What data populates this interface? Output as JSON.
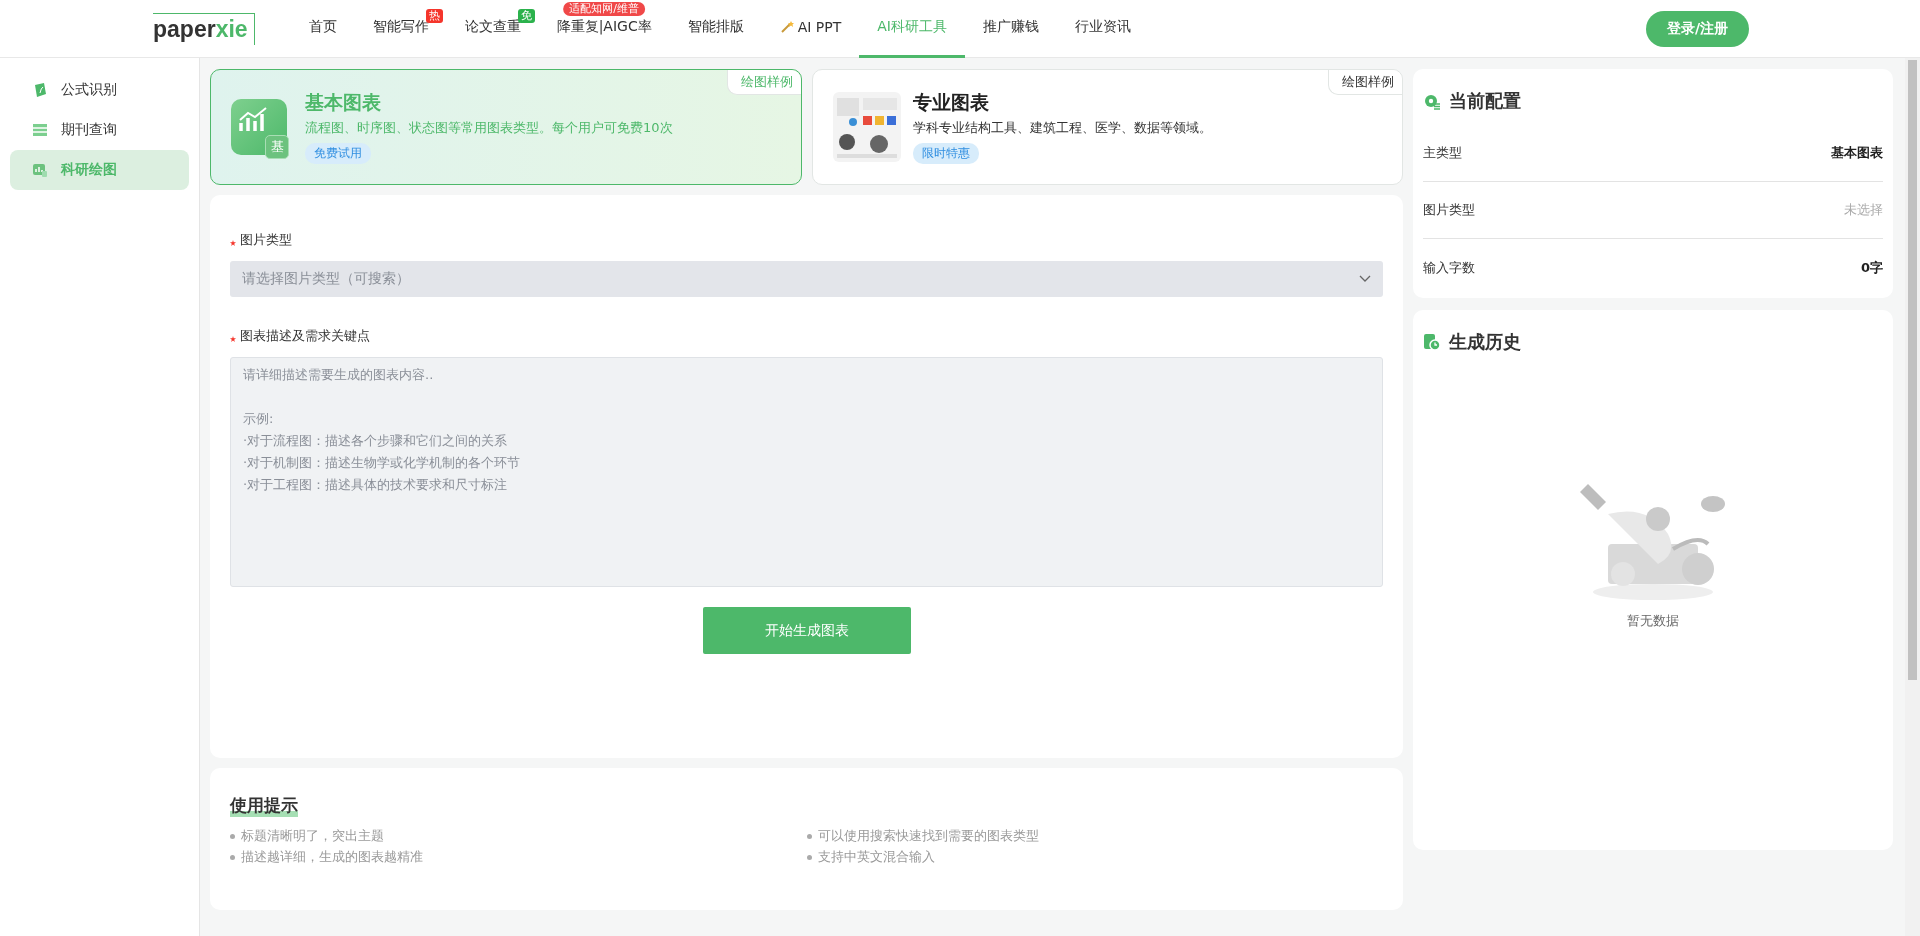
{
  "header": {
    "logo": {
      "dark": "paper",
      "green": "xie"
    },
    "nav": [
      {
        "label": "首页",
        "selected": false
      },
      {
        "label": "智能写作",
        "selected": false,
        "badge": {
          "text": "热",
          "kind": "corner",
          "color": "#f5352b"
        }
      },
      {
        "label": "论文查重",
        "selected": false,
        "badge": {
          "text": "免",
          "kind": "corner",
          "color": "#2bb24c"
        }
      },
      {
        "label": "降重复|AIGC率",
        "selected": false,
        "badge": {
          "text": "适配知网/维普",
          "kind": "pill",
          "color": "#f04848"
        }
      },
      {
        "label": "智能排版",
        "selected": false
      },
      {
        "label": "AI PPT",
        "selected": false,
        "kind": "icon"
      },
      {
        "label": "AI科研工具",
        "selected": true
      },
      {
        "label": "推广赚钱",
        "selected": false
      },
      {
        "label": "行业资讯",
        "selected": false
      }
    ],
    "login_button": "登录/注册"
  },
  "sidebar": {
    "items": [
      {
        "label": "公式识别",
        "selected": false
      },
      {
        "label": "期刊查询",
        "selected": false
      },
      {
        "label": "科研绘图",
        "selected": true
      }
    ]
  },
  "type_cards": [
    {
      "title": "基本图表",
      "description": "流程图、时序图、状态图等常用图表类型。每个用户可免费10次",
      "tag": "免费试用",
      "example_link": "绘图样例",
      "selected": true,
      "kind": "icon",
      "icon_label": "基"
    },
    {
      "title": "专业图表",
      "description": "学科专业结构工具、建筑工程、医学、数据等领域。",
      "tag": "限时特惠",
      "example_link": "绘图样例",
      "selected": false,
      "kind": "picture"
    }
  ],
  "form": {
    "image_type": {
      "label": "图片类型",
      "required": true,
      "placeholder": "请选择图片类型（可搜索）"
    },
    "description": {
      "label": "图表描述及需求关键点",
      "required": true,
      "placeholder": "请详细描述需要生成的图表内容..\n\n示例:\n·对于流程图：描述各个步骤和它们之间的关系\n·对于机制图：描述生物学或化学机制的各个环节\n·对于工程图：描述具体的技术要求和尺寸标注"
    },
    "submit_button": "开始生成图表"
  },
  "tips": {
    "title": "使用提示",
    "items": [
      "标题清晰明了，突出主题",
      "可以使用搜索快速找到需要的图表类型",
      "描述越详细，生成的图表越精准",
      "支持中英文混合输入"
    ]
  },
  "config": {
    "title": "当前配置",
    "rows": [
      {
        "label": "主类型",
        "value": "基本图表",
        "empty": false
      },
      {
        "label": "图片类型",
        "value": "未选择",
        "empty": true
      },
      {
        "label": "输入字数",
        "value": "0字",
        "empty": false
      }
    ]
  },
  "history": {
    "title": "生成历史",
    "empty_text": "暂无数据"
  }
}
